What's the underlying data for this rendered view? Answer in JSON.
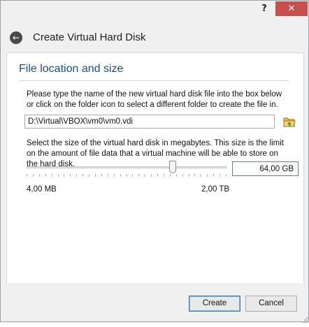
{
  "titlebar": {
    "help_label": "?",
    "close_label": "✕"
  },
  "header": {
    "title": "Create Virtual Hard Disk"
  },
  "section": {
    "title": "File location and size"
  },
  "file": {
    "description": "Please type the name of the new virtual hard disk file into the box below or click on the folder icon to select a different folder to create the file in.",
    "path": "D:\\Virtual\\VBOX\\vm0\\vm0.vdi",
    "folder_icon": "folder-open-icon"
  },
  "size": {
    "description": "Select the size of the virtual hard disk in megabytes. This size is the limit on the amount of file data that a virtual machine will be able to store on the hard disk.",
    "value": "64,00 GB",
    "min_label": "4,00 MB",
    "max_label": "2,00 TB",
    "slider_fraction": 0.73
  },
  "buttons": {
    "create": "Create",
    "cancel": "Cancel"
  },
  "colors": {
    "accent": "#1a4e8a",
    "close": "#c7504b",
    "focus": "#4f7fbf"
  }
}
